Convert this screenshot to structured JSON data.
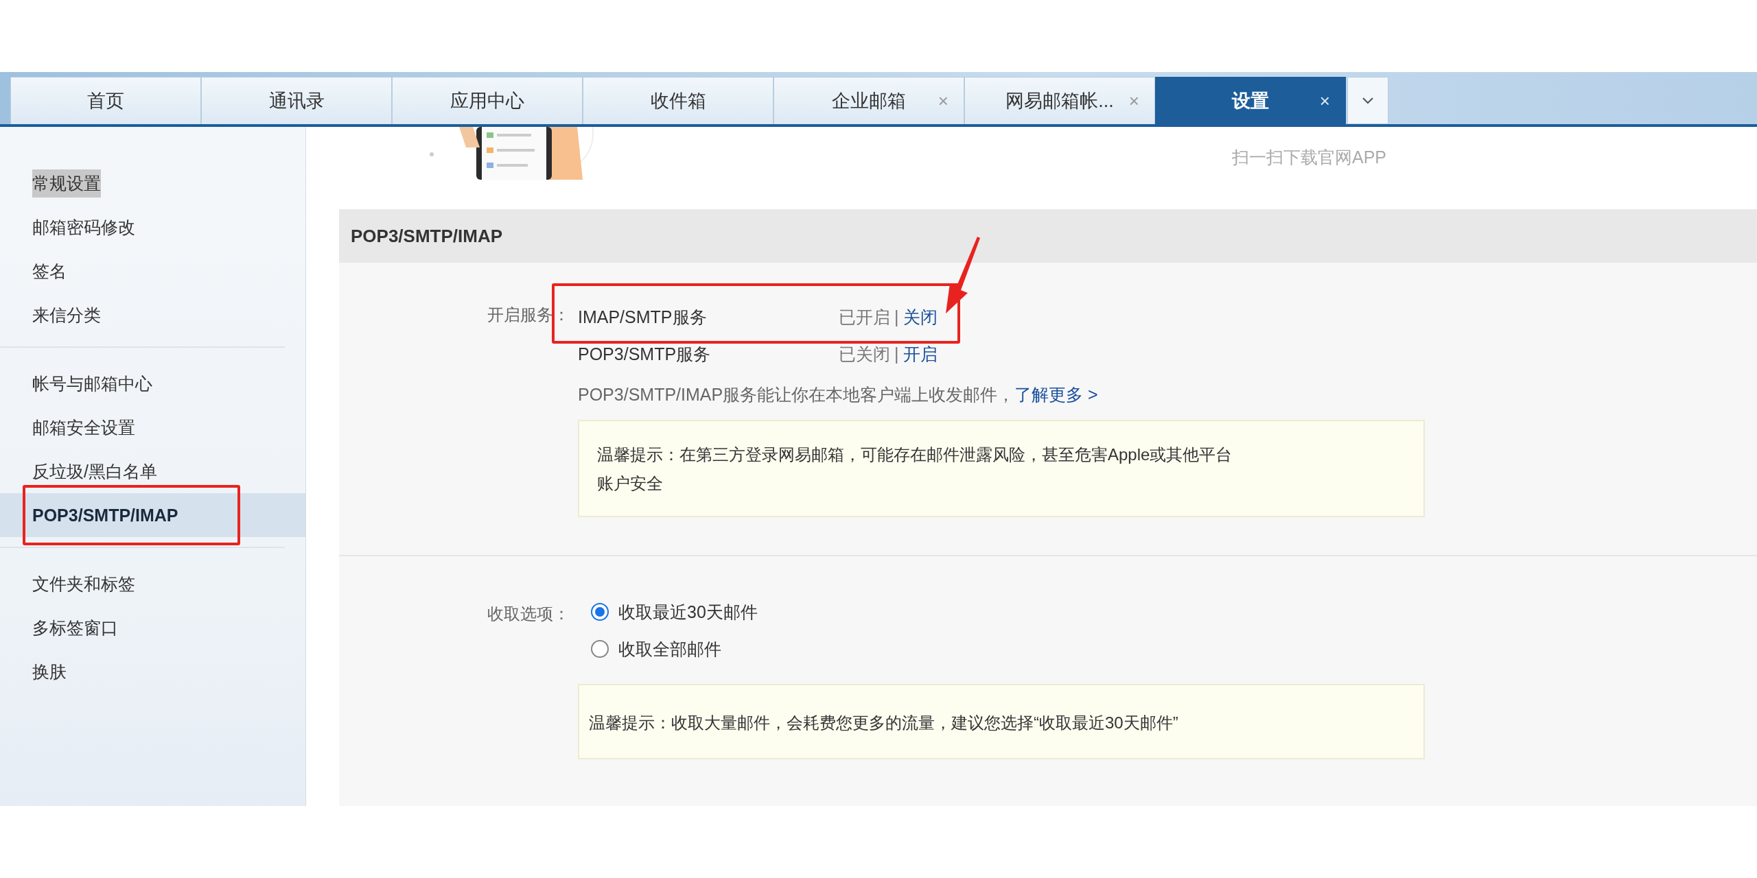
{
  "tabs": [
    {
      "label": "首页",
      "closable": false,
      "selected": false
    },
    {
      "label": "通讯录",
      "closable": false,
      "selected": false
    },
    {
      "label": "应用中心",
      "closable": false,
      "selected": false
    },
    {
      "label": "收件箱",
      "closable": false,
      "selected": false
    },
    {
      "label": "企业邮箱",
      "closable": true,
      "close": "×",
      "selected": false
    },
    {
      "label": "网易邮箱帐...",
      "closable": true,
      "close": "×",
      "selected": false
    },
    {
      "label": "设置",
      "closable": true,
      "close": "×",
      "selected": true
    }
  ],
  "sidebar": {
    "groups": [
      {
        "items": [
          {
            "label": "常规设置",
            "selected": false,
            "hovered": true,
            "annotated": false
          },
          {
            "label": "邮箱密码修改",
            "selected": false,
            "hovered": false,
            "annotated": false
          },
          {
            "label": "签名",
            "selected": false,
            "hovered": false,
            "annotated": false
          },
          {
            "label": "来信分类",
            "selected": false,
            "hovered": false,
            "annotated": false
          }
        ]
      },
      {
        "items": [
          {
            "label": "帐号与邮箱中心",
            "selected": false,
            "hovered": false,
            "annotated": false
          },
          {
            "label": "邮箱安全设置",
            "selected": false,
            "hovered": false,
            "annotated": false
          },
          {
            "label": "反垃圾/黑白名单",
            "selected": false,
            "hovered": false,
            "annotated": false
          },
          {
            "label": "POP3/SMTP/IMAP",
            "selected": true,
            "hovered": false,
            "annotated": true
          }
        ]
      },
      {
        "items": [
          {
            "label": "文件夹和标签",
            "selected": false,
            "hovered": false,
            "annotated": false
          },
          {
            "label": "多标签窗口",
            "selected": false,
            "hovered": false,
            "annotated": false
          },
          {
            "label": "换肤",
            "selected": false,
            "hovered": false,
            "annotated": false
          }
        ]
      }
    ]
  },
  "banner": {
    "caption": "扫一扫下载官网APP"
  },
  "section": {
    "title": "POP3/SMTP/IMAP",
    "service_label": "开启服务：",
    "services": [
      {
        "name": "IMAP/SMTP服务",
        "status": "已开启",
        "separator": "|",
        "action": "关闭",
        "annotated": true
      },
      {
        "name": "POP3/SMTP服务",
        "status": "已关闭",
        "separator": "|",
        "action": "开启",
        "annotated": false
      }
    ],
    "description": "POP3/SMTP/IMAP服务能让你在本地客户端上收发邮件，",
    "more_link": "了解更多 >",
    "tip": "温馨提示：在第三方登录网易邮箱，可能存在邮件泄露风险，甚至危害Apple或其他平台账户安全",
    "fetch_label": "收取选项：",
    "fetch_options": [
      {
        "label": "收取最近30天邮件",
        "selected": true
      },
      {
        "label": "收取全部邮件",
        "selected": false
      }
    ],
    "fetch_tip": "温馨提示：收取大量邮件，会耗费您更多的流量，建议您选择“收取最近30天邮件”"
  }
}
